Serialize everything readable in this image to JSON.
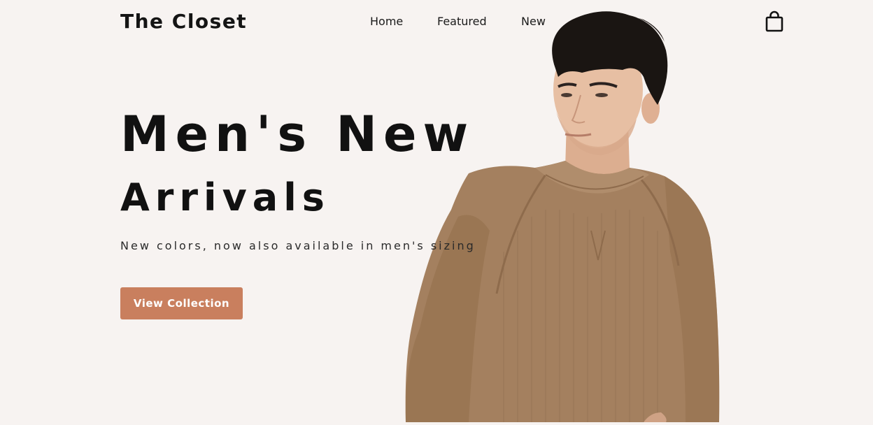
{
  "header": {
    "logo": "The Closet",
    "nav": [
      {
        "label": "Home"
      },
      {
        "label": "Featured"
      },
      {
        "label": "New"
      }
    ],
    "cart_icon": "shopping-bag-icon"
  },
  "hero": {
    "title_line1": "Men's New",
    "title_line2": "Arrivals",
    "subtitle": "New colors, now also available in men's sizing",
    "cta_label": "View Collection",
    "image": "male model wearing a tan knit crewneck sweater"
  },
  "colors": {
    "background": "#f7f3f1",
    "accent": "#c97f5e",
    "text": "#141414",
    "sweater": "#a4805f",
    "hair": "#1a1512",
    "skin": "#e7bfa3"
  }
}
